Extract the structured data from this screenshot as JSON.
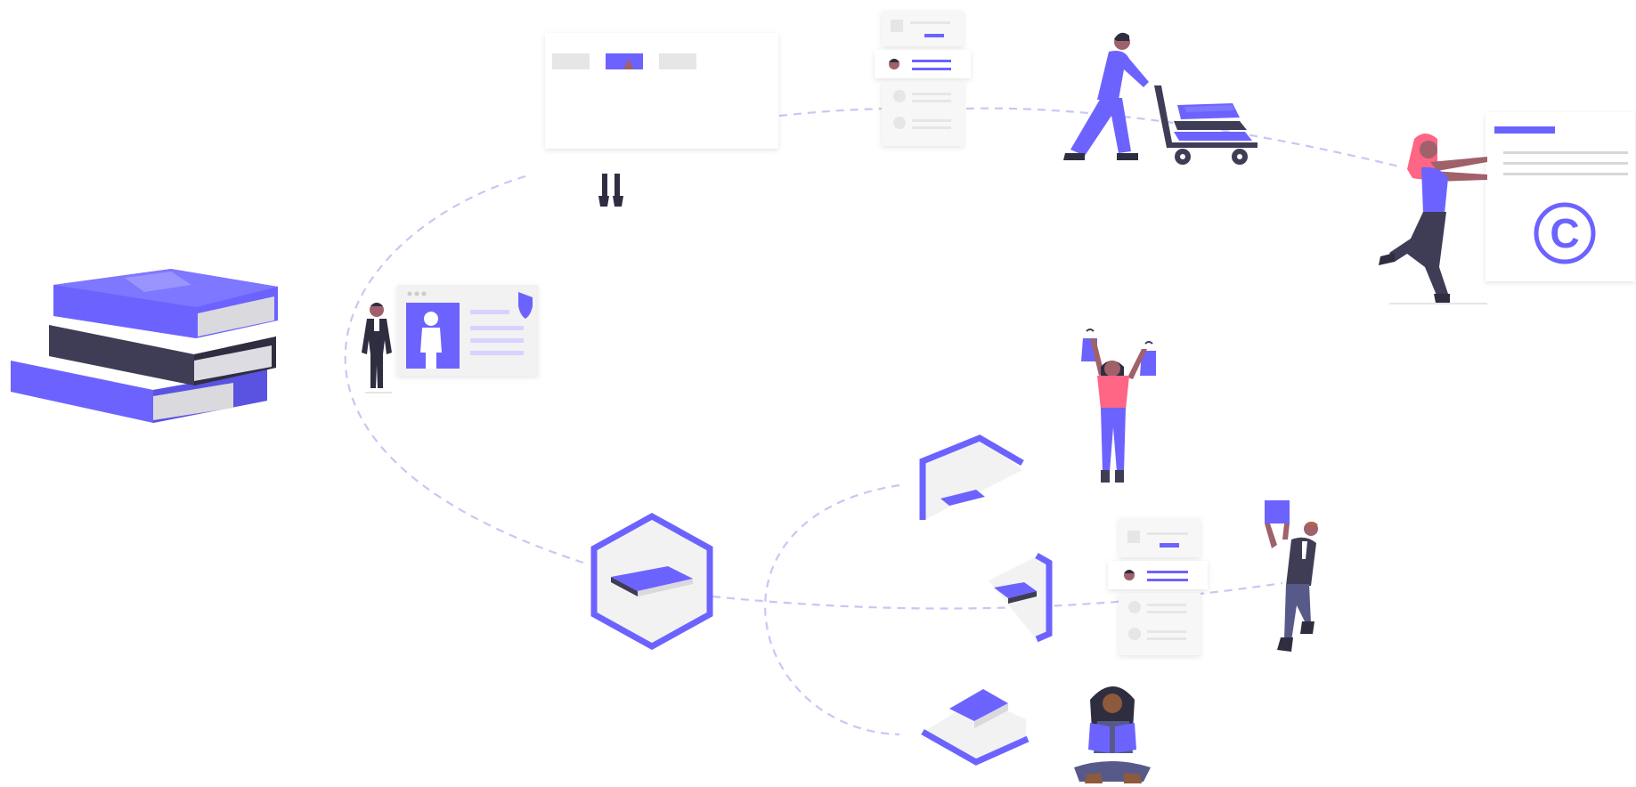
{
  "colors": {
    "accent": "#6c63ff",
    "dark_accent": "#3f3d56",
    "gray_light": "#e6e6e6",
    "gray_mid": "#cccccc",
    "gray_panel": "#f2f2f2",
    "skin": "#a0616a",
    "hair_red": "#ff6584",
    "path_dash": "#c9c6f5"
  },
  "icons": {
    "copyright": "©"
  }
}
